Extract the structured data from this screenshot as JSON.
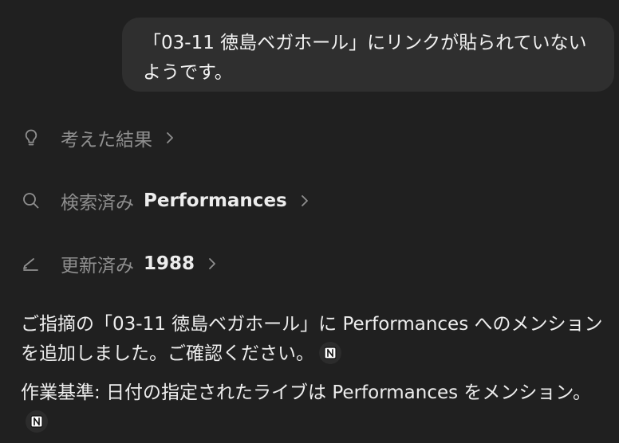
{
  "user_message": {
    "text": "「03-11 徳島ベガホール」にリンクが貼られていないようです。"
  },
  "steps": [
    {
      "icon": "lightbulb-icon",
      "label": "考えた結果",
      "target": ""
    },
    {
      "icon": "search-icon",
      "label": "検索済み",
      "target": "Performances"
    },
    {
      "icon": "pencil-icon",
      "label": "更新済み",
      "target": "1988"
    }
  ],
  "response": {
    "paragraph1": "ご指摘の「03-11 徳島ベガホール」に Performances へのメンションを追加しました。ご確認ください。",
    "paragraph2": "作業基準: 日付の指定されたライブは Performances をメンション。"
  },
  "colors": {
    "background": "#202020",
    "bubble": "#2f2f2f",
    "muted_text": "#8f8f8f",
    "text": "#ededed"
  }
}
